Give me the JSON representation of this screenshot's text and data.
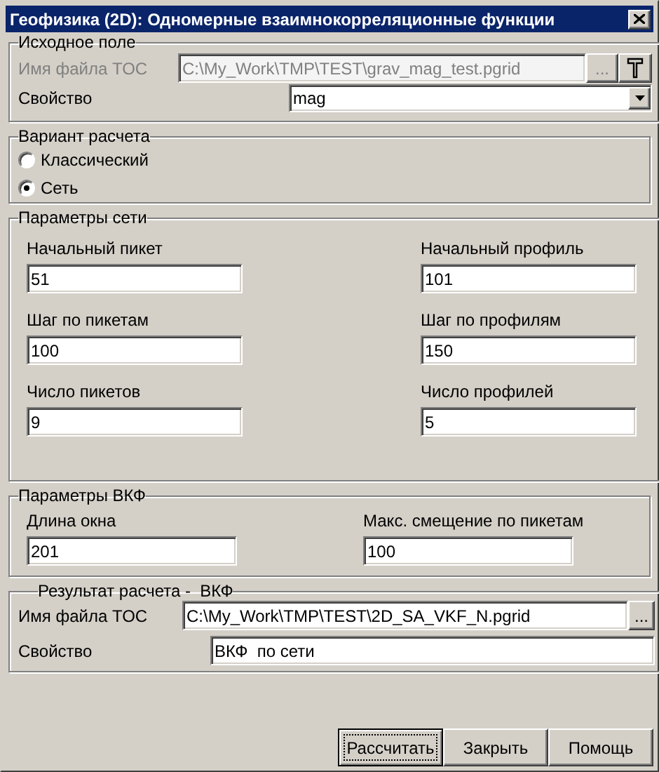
{
  "window": {
    "title": "Геофизика (2D): Одномерные взаимнокорреляционные функции"
  },
  "source": {
    "legend": "Исходное поле",
    "file_label": "Имя файла TOC",
    "file_value": "C:\\My_Work\\TMP\\TEST\\grav_mag_test.pgrid",
    "browse": "...",
    "disabled": true,
    "property_label": "Свойство",
    "property_value": "mag"
  },
  "variant": {
    "legend": "Вариант расчета",
    "options": [
      {
        "label": "Классический",
        "selected": false
      },
      {
        "label": "Сеть",
        "selected": true
      }
    ]
  },
  "grid": {
    "legend": "Параметры сети",
    "fields": [
      {
        "label": "Начальный пикет",
        "value": "51"
      },
      {
        "label": "Начальный профиль",
        "value": "101"
      },
      {
        "label": "Шаг по пикетам",
        "value": "100"
      },
      {
        "label": "Шаг по профилям",
        "value": "150"
      },
      {
        "label": "Число пикетов",
        "value": "9"
      },
      {
        "label": "Число профилей",
        "value": "5"
      }
    ]
  },
  "vkf": {
    "legend": "Параметры ВКФ",
    "fields": [
      {
        "label": "Длина окна",
        "value": "201"
      },
      {
        "label": "Макс. смещение по пикетам",
        "value": "100"
      }
    ]
  },
  "result": {
    "legend": "Результат расчета -  ВКФ",
    "file_label": "Имя файла TOC",
    "file_value": "C:\\My_Work\\TMP\\TEST\\2D_SA_VKF_N.pgrid",
    "browse": "...",
    "property_label": "Свойство",
    "property_value": "ВКФ  по сети"
  },
  "buttons": [
    {
      "label": "Рассчитать",
      "focused": true
    },
    {
      "label": "Закрыть",
      "focused": false
    },
    {
      "label": "Помощь",
      "focused": false
    }
  ]
}
